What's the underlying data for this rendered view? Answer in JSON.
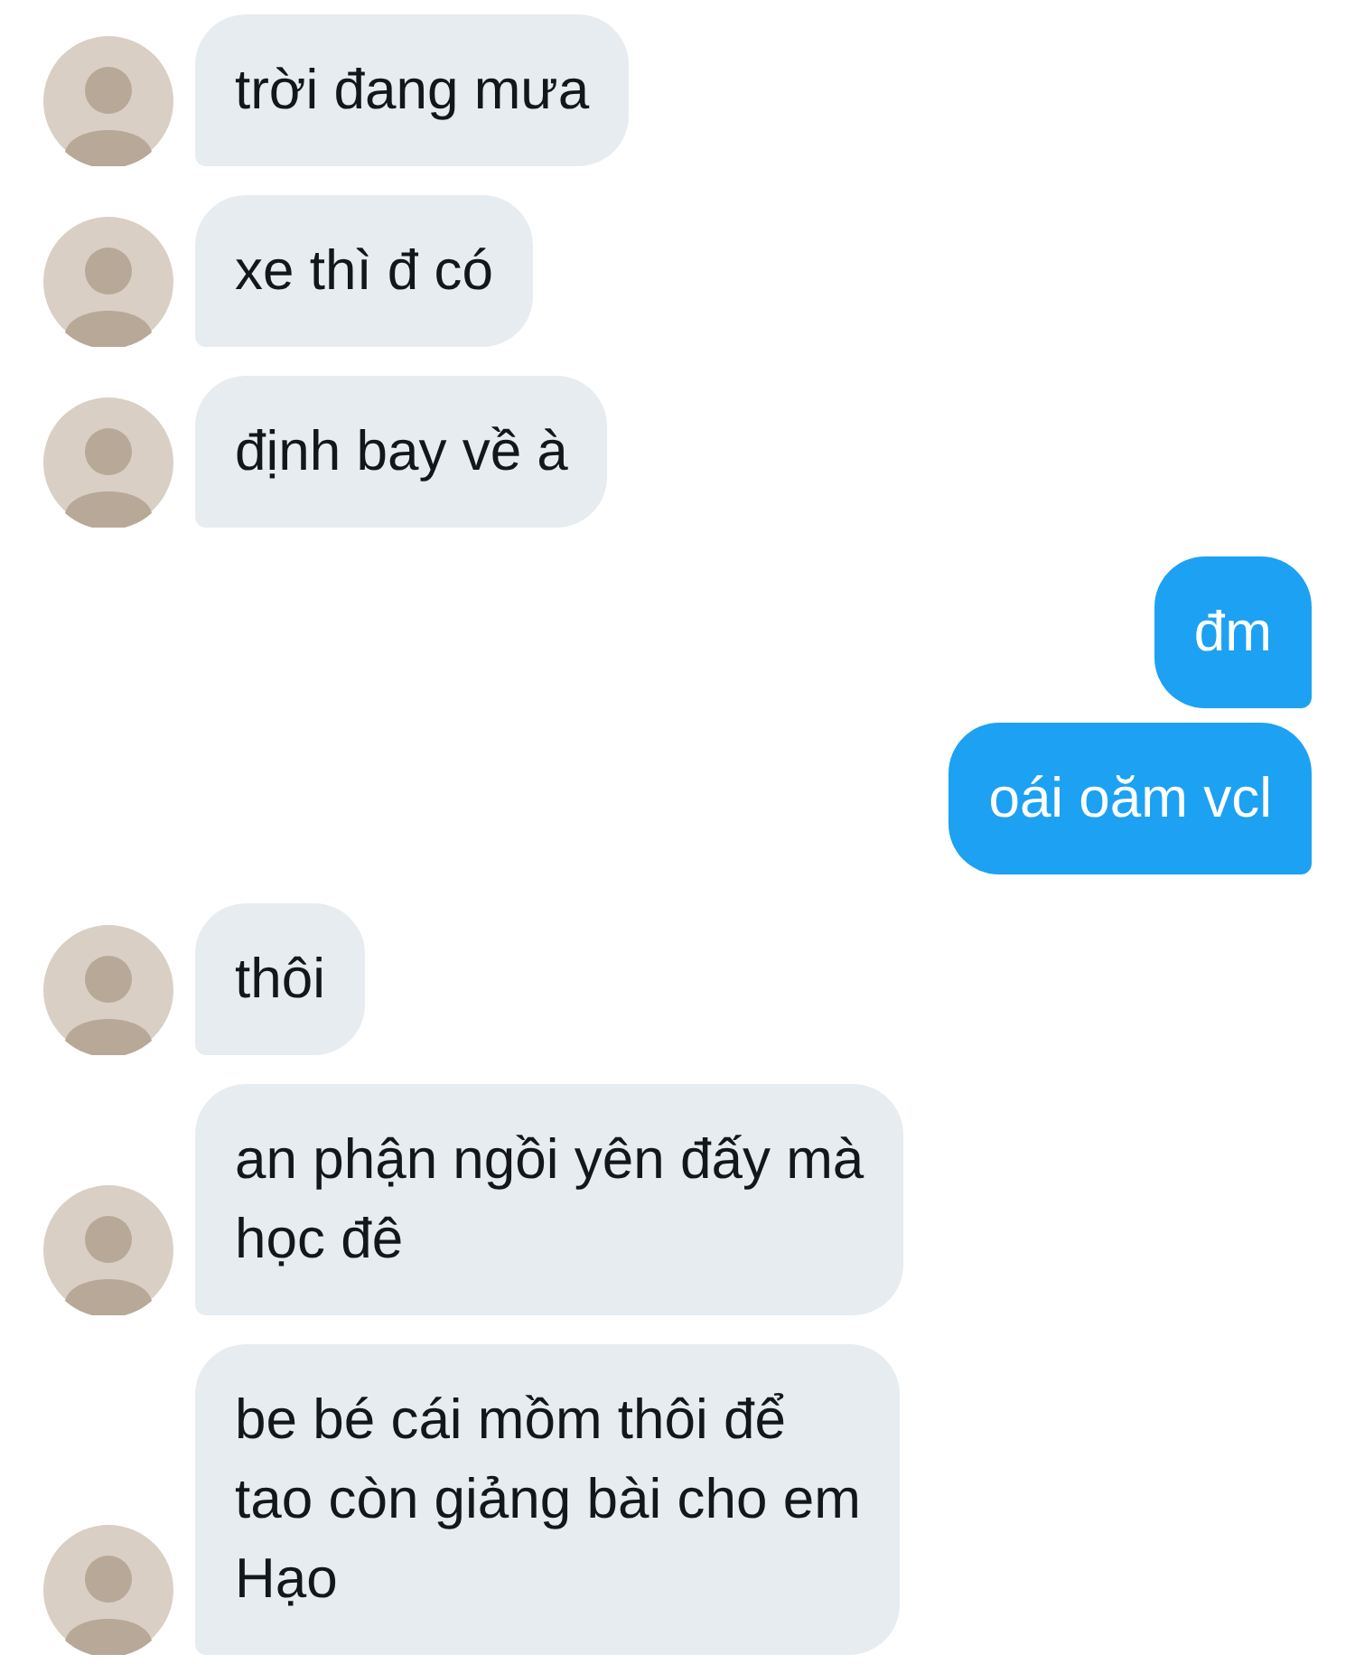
{
  "messages": [
    {
      "kind": "received",
      "text": "trời đang mưa"
    },
    {
      "kind": "received",
      "text": "xe thì đ có"
    },
    {
      "kind": "received",
      "text": "định bay về à"
    },
    {
      "kind": "sent",
      "text": "đm"
    },
    {
      "kind": "sent",
      "text": "oái oăm vcl"
    },
    {
      "kind": "received",
      "text": "thôi"
    },
    {
      "kind": "received",
      "text": "an phận ngồi yên đấy mà\nhọc đê"
    },
    {
      "kind": "received",
      "text": "be bé cái mồm thôi để\ntao còn giảng bài cho em\nHạo"
    }
  ]
}
